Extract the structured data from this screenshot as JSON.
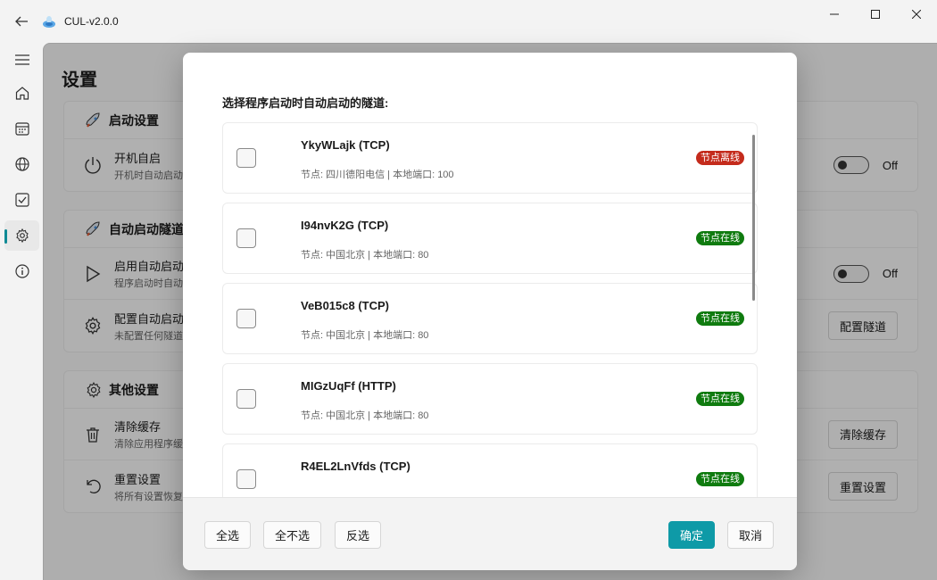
{
  "window": {
    "title": "CUL-v2.0.0"
  },
  "nav": [
    "menu-icon",
    "home-icon",
    "calendar-icon",
    "globe-icon",
    "checkbox-icon",
    "gear-icon",
    "info-icon"
  ],
  "page": {
    "title": "设置",
    "sections": [
      {
        "title": "启动设置",
        "rows": [
          {
            "title": "开机自启",
            "desc": "开机时自动启动",
            "toggle": "Off"
          }
        ]
      },
      {
        "title": "自动启动隧道",
        "rows": [
          {
            "title": "启用自动启动",
            "desc": "程序启动时自动启",
            "toggle": "Off"
          },
          {
            "title": "配置自动启动",
            "desc": "未配置任何隧道",
            "button": "配置隧道"
          }
        ]
      },
      {
        "title": "其他设置",
        "rows": [
          {
            "title": "清除缓存",
            "desc": "清除应用程序缓",
            "button": "清除缓存"
          },
          {
            "title": "重置设置",
            "desc": "将所有设置恢复",
            "button": "重置设置"
          }
        ]
      }
    ]
  },
  "dialog": {
    "heading": "选择程序启动时自动启动的隧道:",
    "tunnels": [
      {
        "name": "YkyWLajk (TCP)",
        "meta": "节点: 四川德阳电信 | 本地端口: 100",
        "status": "节点离线",
        "online": false
      },
      {
        "name": "I94nvK2G (TCP)",
        "meta": "节点: 中国北京 | 本地端口: 80",
        "status": "节点在线",
        "online": true
      },
      {
        "name": "VeB015c8 (TCP)",
        "meta": "节点: 中国北京 | 本地端口: 80",
        "status": "节点在线",
        "online": true
      },
      {
        "name": "MIGzUqFf (HTTP)",
        "meta": "节点: 中国北京 | 本地端口: 80",
        "status": "节点在线",
        "online": true
      },
      {
        "name": "R4EL2LnVfds (TCP)",
        "meta": "",
        "status": "节点在线",
        "online": true
      }
    ],
    "buttons": {
      "select_all": "全选",
      "select_none": "全不选",
      "invert": "反选",
      "confirm": "确定",
      "cancel": "取消"
    }
  },
  "colors": {
    "accent": "#0e9aa7",
    "online": "#0f7b0f",
    "offline": "#c42b1c"
  }
}
